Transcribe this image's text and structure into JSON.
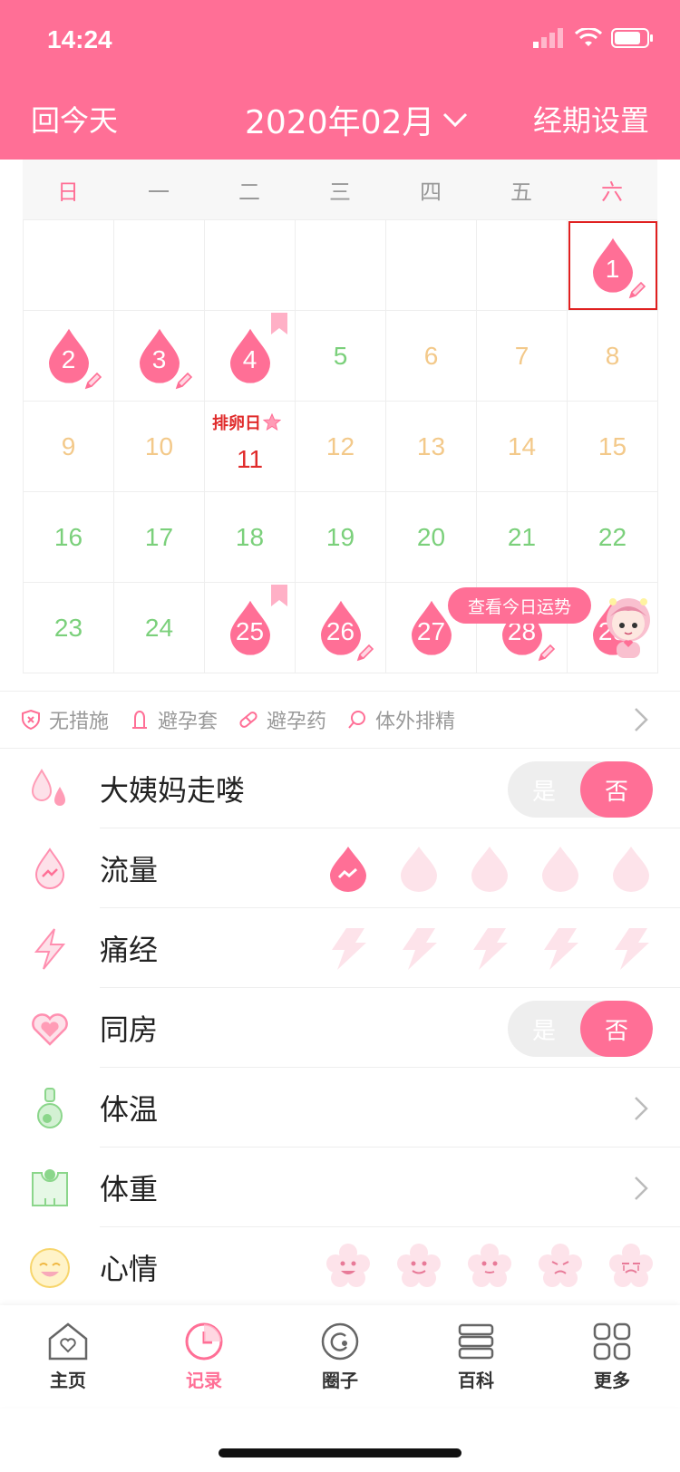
{
  "status": {
    "time": "14:24"
  },
  "nav": {
    "back_today": "回今天",
    "month": "2020年02月",
    "period_settings": "经期设置"
  },
  "weekdays": [
    "日",
    "一",
    "二",
    "三",
    "四",
    "五",
    "六"
  ],
  "calendar": {
    "ovulation_label": "排卵日",
    "fortune_button": "查看今日运势"
  },
  "contraception": [
    "无措施",
    "避孕套",
    "避孕药",
    "体外排精"
  ],
  "records": {
    "period": {
      "label": "大姨妈走喽",
      "yes": "是",
      "no": "否"
    },
    "flow": {
      "label": "流量",
      "level": 1
    },
    "pain": {
      "label": "痛经",
      "level": 0
    },
    "sex": {
      "label": "同房",
      "yes": "是",
      "no": "否"
    },
    "temperature": {
      "label": "体温"
    },
    "weight": {
      "label": "体重"
    },
    "mood": {
      "label": "心情"
    }
  },
  "tabs": [
    {
      "label": "主页",
      "icon": "home-icon"
    },
    {
      "label": "记录",
      "icon": "clock-icon"
    },
    {
      "label": "圈子",
      "icon": "circle-icon"
    },
    {
      "label": "百科",
      "icon": "book-icon"
    },
    {
      "label": "更多",
      "icon": "grid-icon"
    }
  ],
  "colors": {
    "accent": "#ff6f96",
    "green": "#7bd07b",
    "yellow": "#f3c98a",
    "red": "#e02b2b"
  }
}
